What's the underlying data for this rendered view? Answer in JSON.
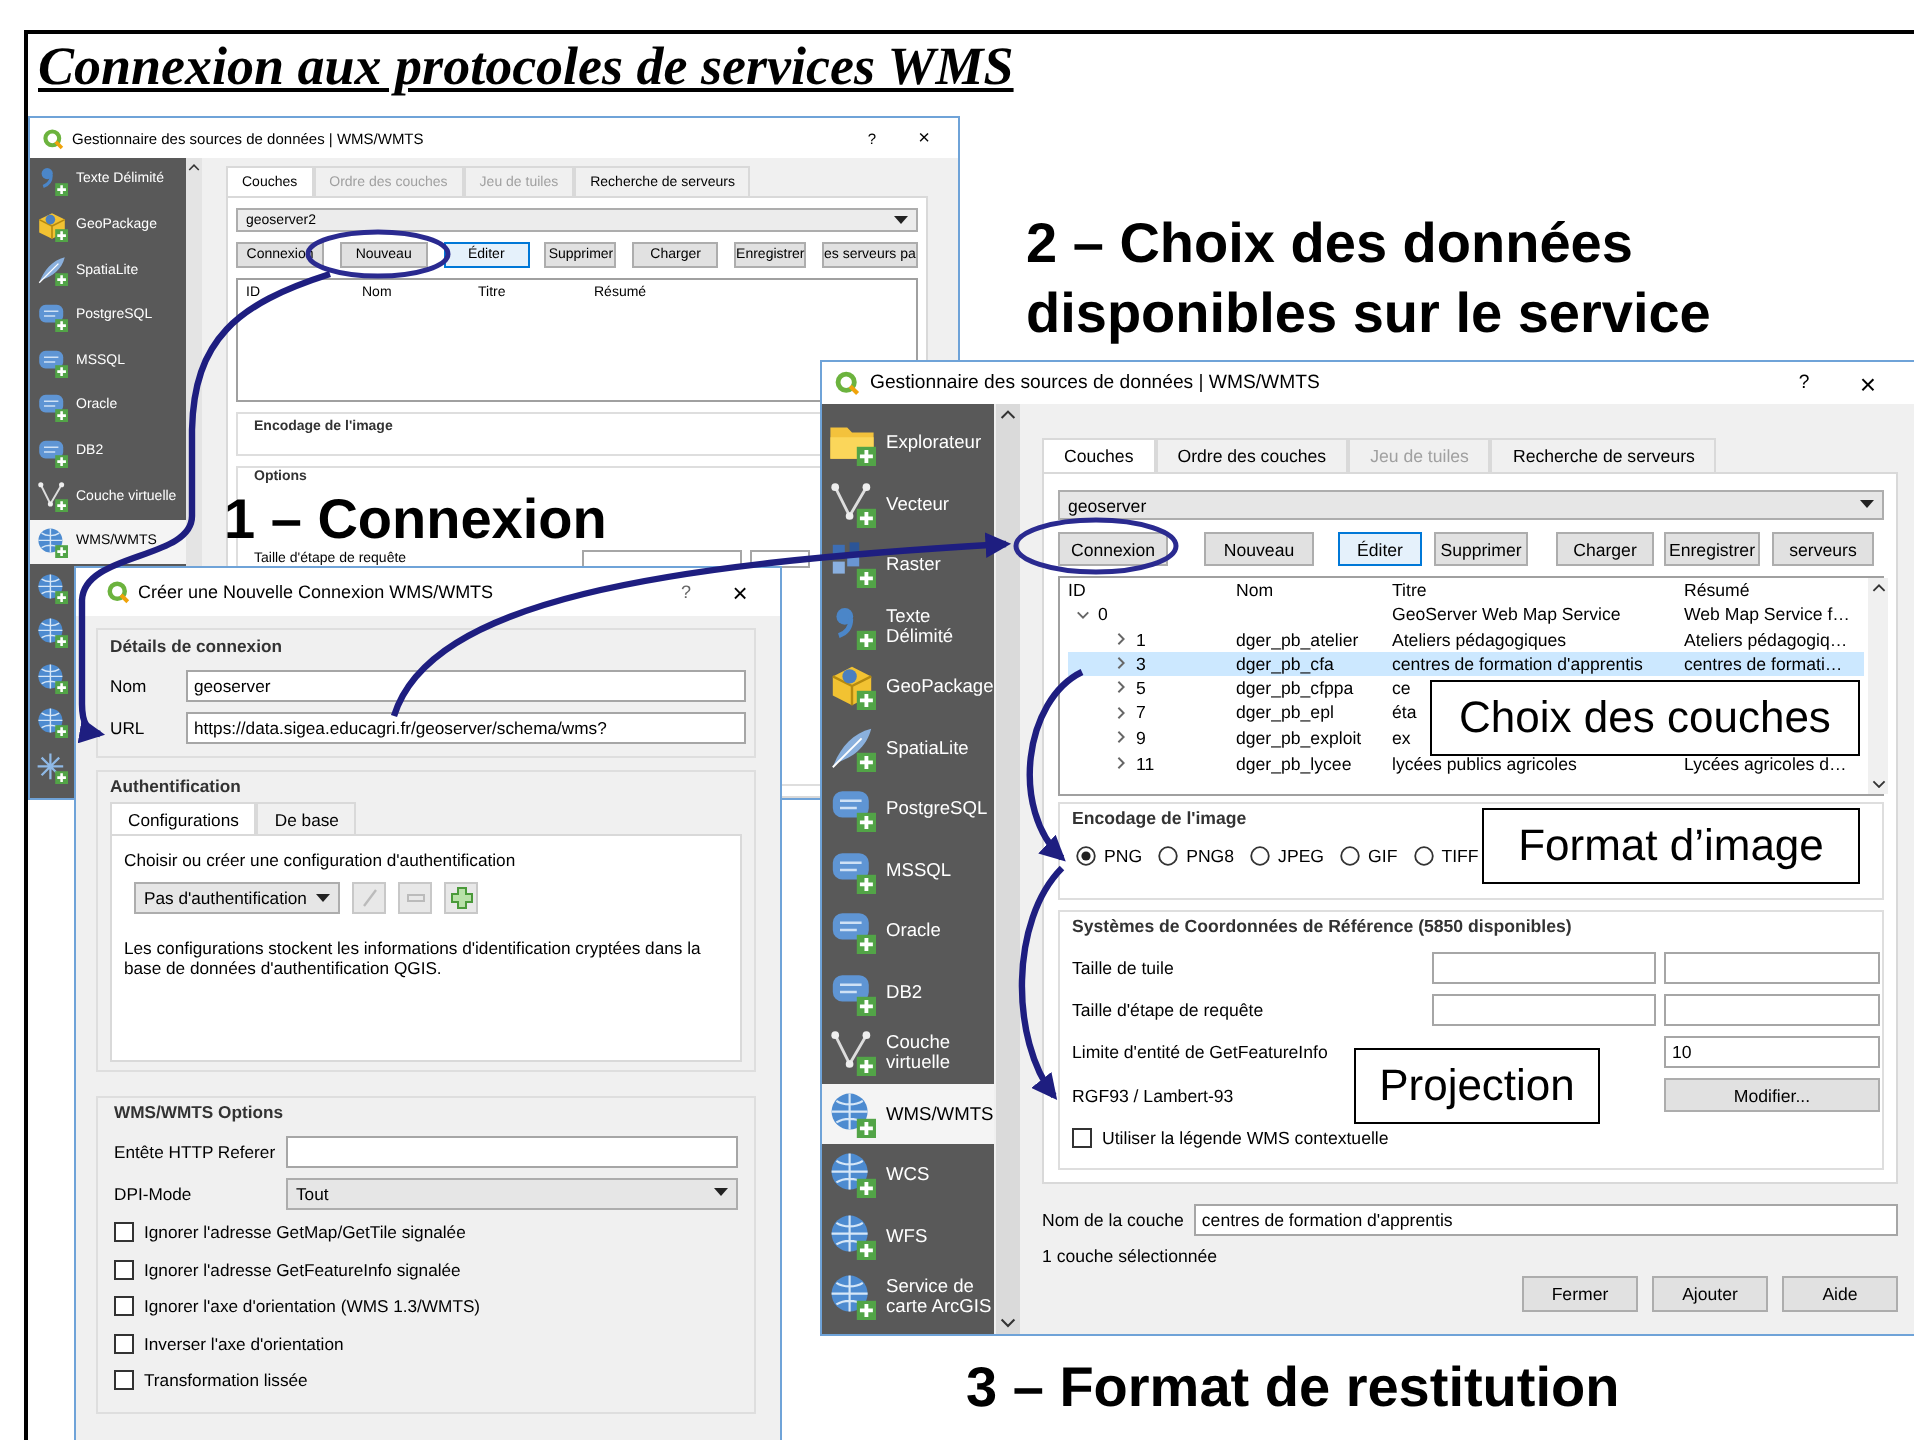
{
  "title": "Connexion aux protocoles de services WMS",
  "back_window": {
    "title": "Gestionnaire des sources de données | WMS/WMTS",
    "help": "?",
    "close": "×",
    "sidebar": [
      {
        "label": "Texte Délimité",
        "selected": false
      },
      {
        "label": "GeoPackage",
        "selected": false
      },
      {
        "label": "SpatiaLite",
        "selected": false
      },
      {
        "label": "PostgreSQL",
        "selected": false
      },
      {
        "label": "MSSQL",
        "selected": false
      },
      {
        "label": "Oracle",
        "selected": false
      },
      {
        "label": "DB2",
        "selected": false
      },
      {
        "label": "Couche virtuelle",
        "selected": false
      },
      {
        "label": "WMS/WMTS",
        "selected": true
      }
    ],
    "tabs": [
      {
        "label": "Couches",
        "selected": true,
        "disabled": false
      },
      {
        "label": "Ordre des couches",
        "selected": false,
        "disabled": true
      },
      {
        "label": "Jeu de tuiles",
        "selected": false,
        "disabled": true
      },
      {
        "label": "Recherche de serveurs",
        "selected": false,
        "disabled": false
      }
    ],
    "connection": "geoserver2",
    "buttons": [
      {
        "label": "Connexion",
        "default": false
      },
      {
        "label": "Nouveau",
        "default": false
      },
      {
        "label": "Éditer",
        "default": true
      },
      {
        "label": "Supprimer",
        "default": false
      },
      {
        "label": "Charger",
        "default": false
      },
      {
        "label": "Enregistrer",
        "default": false
      },
      {
        "label": "es serveurs pa",
        "default": false
      }
    ],
    "columns": [
      "ID",
      "Nom",
      "Titre",
      "Résumé"
    ],
    "encoding_heading": "Encodage de l'image",
    "options_heading": "Options",
    "option_rows": [
      "Taille d'étape de requête"
    ]
  },
  "connection_dialog": {
    "title": "Créer une Nouvelle Connexion WMS/WMTS",
    "help": "?",
    "close": "×",
    "details_heading": "Détails de connexion",
    "fields": [
      {
        "label": "Nom",
        "value": "geoserver"
      },
      {
        "label": "URL",
        "value": "https://data.sigea.educagri.fr/geoserver/schema/wms?"
      }
    ],
    "auth_heading": "Authentification",
    "auth_tabs": [
      {
        "label": "Configurations",
        "selected": true
      },
      {
        "label": "De base",
        "selected": false
      }
    ],
    "auth_prompt": "Choisir ou créer une configuration d'authentification",
    "auth_config": "Pas d'authentification",
    "auth_note": "Les configurations stockent les informations d'identification cryptées dans la base de données d'authentification QGIS.",
    "options_heading": "WMS/WMTS Options",
    "referer_label": "Entête HTTP Referer",
    "dpi_label": "DPI-Mode",
    "dpi_value": "Tout",
    "checkboxes": [
      {
        "label": "Ignorer l'adresse GetMap/GetTile signalée",
        "checked": false
      },
      {
        "label": "Ignorer l'adresse GetFeatureInfo signalée",
        "checked": false
      },
      {
        "label": "Ignorer l'axe d'orientation (WMS 1.3/WMTS)",
        "checked": false
      },
      {
        "label": "Inverser l'axe d'orientation",
        "checked": false
      },
      {
        "label": "Transformation lissée",
        "checked": false
      }
    ]
  },
  "front_window": {
    "title": "Gestionnaire des sources de données | WMS/WMTS",
    "help": "?",
    "close": "×",
    "sidebar": [
      {
        "label": "Explorateur",
        "selected": false
      },
      {
        "label": "Vecteur",
        "selected": false
      },
      {
        "label": "Raster",
        "selected": false
      },
      {
        "label": "Texte Délimité",
        "selected": false
      },
      {
        "label": "GeoPackage",
        "selected": false
      },
      {
        "label": "SpatiaLite",
        "selected": false
      },
      {
        "label": "PostgreSQL",
        "selected": false
      },
      {
        "label": "MSSQL",
        "selected": false
      },
      {
        "label": "Oracle",
        "selected": false
      },
      {
        "label": "DB2",
        "selected": false
      },
      {
        "label": "Couche virtuelle",
        "selected": false
      },
      {
        "label": "WMS/WMTS",
        "selected": true
      },
      {
        "label": "WCS",
        "selected": false
      },
      {
        "label": "WFS",
        "selected": false
      },
      {
        "label": "Service de carte ArcGIS",
        "selected": false
      }
    ],
    "tabs": [
      {
        "label": "Couches",
        "selected": true,
        "disabled": false
      },
      {
        "label": "Ordre des couches",
        "selected": false,
        "disabled": false
      },
      {
        "label": "Jeu de tuiles",
        "selected": false,
        "disabled": true
      },
      {
        "label": "Recherche de serveurs",
        "selected": false,
        "disabled": false
      }
    ],
    "connection": "geoserver",
    "buttons": [
      {
        "label": "Connexion",
        "default": false
      },
      {
        "label": "Nouveau",
        "default": false
      },
      {
        "label": "Éditer",
        "default": true
      },
      {
        "label": "Supprimer",
        "default": false
      },
      {
        "label": "Charger",
        "default": false
      },
      {
        "label": "Enregistrer",
        "default": false
      },
      {
        "label": "serveurs",
        "default": false
      }
    ],
    "columns": [
      "ID",
      "Nom",
      "Titre",
      "Résumé"
    ],
    "layers": [
      {
        "id": "0",
        "title": "GeoServer Web Map Service",
        "abstract": "Web Map Service f…",
        "expanded": true,
        "selected": false,
        "children": [
          {
            "id": "1",
            "name": "dger_pb_atelier",
            "title": "Ateliers pédagogiques",
            "abstract": "Ateliers pédagogiq…",
            "expanded": false,
            "selected": false
          },
          {
            "id": "3",
            "name": "dger_pb_cfa",
            "title": "centres de formation d'apprentis",
            "abstract": "centres de formati…",
            "expanded": false,
            "selected": true
          },
          {
            "id": "5",
            "name": "dger_pb_cfppa",
            "title": "ce",
            "expanded": false,
            "selected": false
          },
          {
            "id": "7",
            "name": "dger_pb_epl",
            "title": "éta",
            "expanded": false,
            "selected": false
          },
          {
            "id": "9",
            "name": "dger_pb_exploit",
            "title": "ex",
            "expanded": false,
            "selected": false
          },
          {
            "id": "11",
            "name": "dger_pb_lycee",
            "title": "lycées publics agricoles",
            "abstract": "Lycées agricoles d…",
            "expanded": false,
            "selected": false
          }
        ]
      }
    ],
    "encoding_heading": "Encodage de l'image",
    "formats": [
      {
        "label": "PNG",
        "selected": true
      },
      {
        "label": "PNG8",
        "selected": false
      },
      {
        "label": "JPEG",
        "selected": false
      },
      {
        "label": "GIF",
        "selected": false
      },
      {
        "label": "TIFF",
        "selected": false
      }
    ],
    "crs_heading": "Systèmes de Coordonnées de Référence (5850 disponibles)",
    "tile_size_label": "Taille de tuile",
    "step_size_label": "Taille d'étape de requête",
    "feature_limit_label": "Limite d'entité de GetFeatureInfo",
    "feature_limit": "10",
    "projection": "RGF93 / Lambert-93",
    "change_button": "Modifier...",
    "legend": {
      "label": "Utiliser la légende WMS contextuelle",
      "checked": false
    },
    "layer_name_label": "Nom de la couche",
    "layer_name": "centres de formation d'apprentis",
    "status": "1 couche sélectionnée",
    "footer_buttons": [
      "Fermer",
      "Ajouter",
      "Aide"
    ]
  },
  "annotations": [
    "1 – Connexion",
    "2 – Choix des données disponibles sur le service",
    "3 – Format de restitution"
  ],
  "callouts": [
    "Choix des couches",
    "Format d’image",
    "Projection"
  ]
}
